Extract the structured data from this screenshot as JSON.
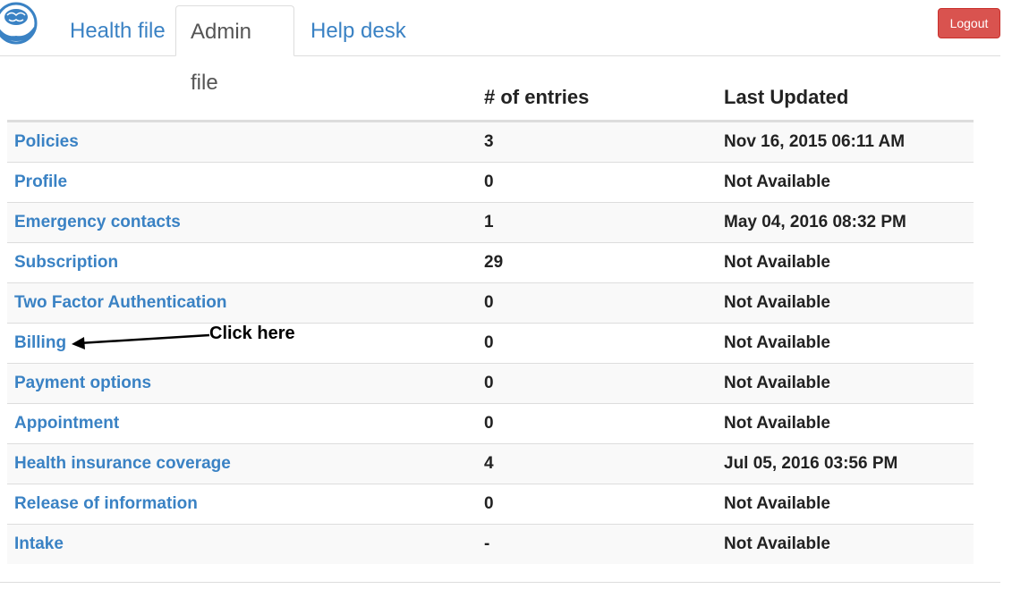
{
  "nav": {
    "tabs": [
      {
        "label": "Health file",
        "active": false
      },
      {
        "label": "Admin file",
        "active": true
      },
      {
        "label": "Help desk",
        "active": false
      }
    ],
    "logout_label": "Logout"
  },
  "table": {
    "headers": {
      "name": "",
      "entries": "# of entries",
      "updated": "Last Updated"
    },
    "rows": [
      {
        "name": "Policies",
        "entries": "3",
        "updated": "Nov 16, 2015 06:11 AM"
      },
      {
        "name": "Profile",
        "entries": "0",
        "updated": "Not Available"
      },
      {
        "name": "Emergency contacts",
        "entries": "1",
        "updated": "May 04, 2016 08:32 PM"
      },
      {
        "name": "Subscription",
        "entries": "29",
        "updated": "Not Available"
      },
      {
        "name": "Two Factor Authentication",
        "entries": "0",
        "updated": "Not Available"
      },
      {
        "name": "Billing",
        "entries": "0",
        "updated": "Not Available"
      },
      {
        "name": "Payment options",
        "entries": "0",
        "updated": "Not Available"
      },
      {
        "name": "Appointment",
        "entries": "0",
        "updated": "Not Available"
      },
      {
        "name": "Health insurance coverage",
        "entries": "4",
        "updated": "Jul 05, 2016 03:56 PM"
      },
      {
        "name": "Release of information",
        "entries": "0",
        "updated": "Not Available"
      },
      {
        "name": "Intake",
        "entries": "-",
        "updated": "Not Available"
      }
    ]
  },
  "annotation": {
    "text": "Click here"
  },
  "colors": {
    "link": "#3a82c4",
    "logout": "#d9534f",
    "stripe": "#f9f9f9"
  },
  "icons": {
    "logo": "brain-hands-logo-icon",
    "arrow": "left-arrow-icon"
  }
}
